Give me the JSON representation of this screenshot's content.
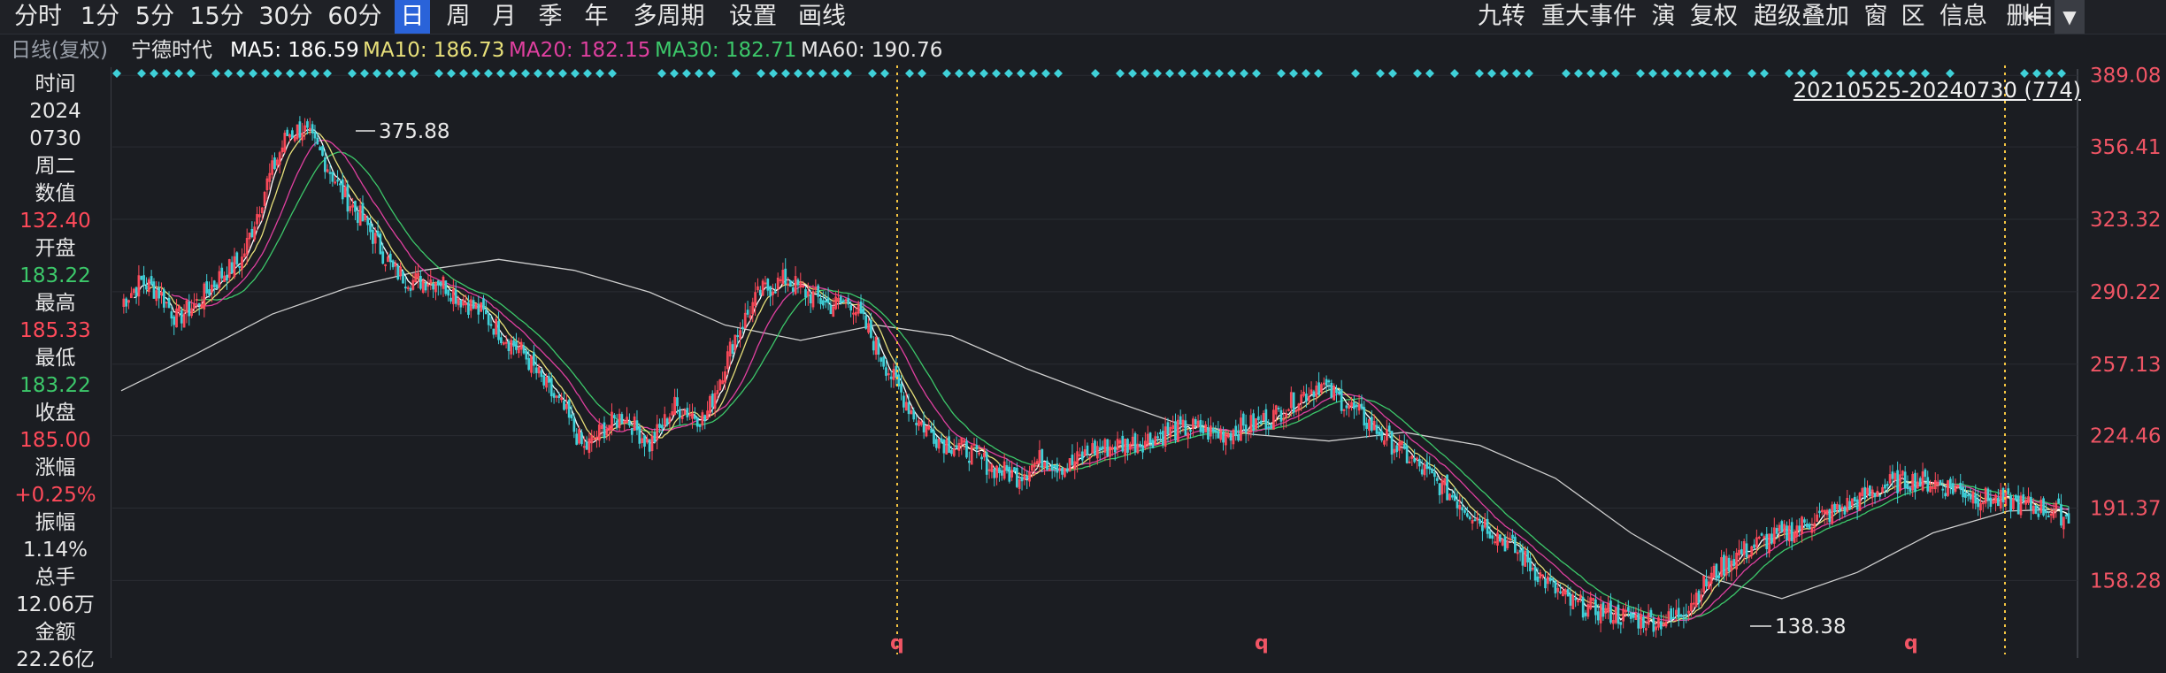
{
  "toolbar": {
    "left": [
      "分时",
      "1分",
      "5分",
      "15分",
      "30分",
      "60分",
      "日",
      "周",
      "月",
      "季",
      "年",
      "多周期",
      "设置",
      "画线"
    ],
    "active": "日",
    "right": [
      "九转",
      "重大事件",
      "演",
      "复权",
      "超级叠加",
      "窗",
      "区",
      "信息",
      "删自选"
    ],
    "collapse_icon": "collapse-icon",
    "dropdown_icon": "chevron-down-icon"
  },
  "info": {
    "period": "日线(复权)",
    "stock": "宁德时代",
    "ma5": "MA5: 186.59",
    "ma10": "MA10: 186.73",
    "ma20": "MA20: 182.15",
    "ma30": "MA30: 182.71",
    "ma60": "MA60: 190.76"
  },
  "panel": {
    "time_label": "时间",
    "date_year": "2024",
    "date_md": "0730",
    "weekday": "周二",
    "value_label": "数值",
    "value": "132.40",
    "open_label": "开盘",
    "open": "183.22",
    "high_label": "最高",
    "high": "185.33",
    "low_label": "最低",
    "low": "183.22",
    "close_label": "收盘",
    "close": "185.00",
    "change_label": "涨幅",
    "change": "+0.25%",
    "amplitude_label": "振幅",
    "amplitude": "1.14%",
    "volume_label": "总手",
    "volume": "12.06万",
    "amount_label": "金额",
    "amount": "22.26亿"
  },
  "range": "20210525-20240730 (774)",
  "colors": {
    "bg": "#1b1d22",
    "up": "#ff4a5a",
    "down": "#3fd0d8",
    "ma5": "#ffffff",
    "ma10": "#e8e07a",
    "ma20": "#e040a0",
    "ma30": "#3cc86a",
    "ma60": "#cfcfcf",
    "axis_text": "#f05565",
    "vline": "#f5c542"
  },
  "chart_data": {
    "type": "line",
    "title": "",
    "ylim": [
      135,
      392
    ],
    "y_ticks": [
      389.08,
      356.41,
      323.32,
      290.22,
      257.13,
      224.46,
      191.37,
      158.28
    ],
    "annotations": [
      {
        "text": "375.88",
        "date": "2021-12"
      },
      {
        "text": "138.38",
        "date": "2024-02"
      }
    ],
    "markers": [
      {
        "text": "q",
        "label": "vertical-marker"
      },
      {
        "text": "q",
        "label": "mid-marker"
      },
      {
        "text": "q",
        "label": "right-marker"
      }
    ],
    "close_path": [
      [
        0,
        285
      ],
      [
        8,
        295
      ],
      [
        15,
        290
      ],
      [
        22,
        278
      ],
      [
        30,
        285
      ],
      [
        40,
        298
      ],
      [
        48,
        305
      ],
      [
        58,
        340
      ],
      [
        66,
        362
      ],
      [
        72,
        365
      ],
      [
        80,
        352
      ],
      [
        88,
        335
      ],
      [
        98,
        320
      ],
      [
        108,
        300
      ],
      [
        116,
        295
      ],
      [
        126,
        296
      ],
      [
        134,
        288
      ],
      [
        144,
        280
      ],
      [
        152,
        270
      ],
      [
        160,
        262
      ],
      [
        168,
        248
      ],
      [
        176,
        236
      ],
      [
        184,
        218
      ],
      [
        192,
        228
      ],
      [
        200,
        234
      ],
      [
        210,
        220
      ],
      [
        220,
        238
      ],
      [
        232,
        232
      ],
      [
        244,
        270
      ],
      [
        254,
        290
      ],
      [
        264,
        296
      ],
      [
        272,
        290
      ],
      [
        282,
        284
      ],
      [
        290,
        286
      ],
      [
        298,
        270
      ],
      [
        306,
        252
      ],
      [
        316,
        232
      ],
      [
        326,
        222
      ],
      [
        336,
        218
      ],
      [
        346,
        210
      ],
      [
        356,
        206
      ],
      [
        366,
        214
      ],
      [
        376,
        210
      ],
      [
        386,
        218
      ],
      [
        396,
        220
      ],
      [
        406,
        222
      ],
      [
        416,
        226
      ],
      [
        426,
        228
      ],
      [
        436,
        225
      ],
      [
        446,
        228
      ],
      [
        456,
        232
      ],
      [
        466,
        240
      ],
      [
        476,
        248
      ],
      [
        486,
        240
      ],
      [
        496,
        230
      ],
      [
        506,
        220
      ],
      [
        516,
        210
      ],
      [
        526,
        200
      ],
      [
        536,
        190
      ],
      [
        546,
        180
      ],
      [
        556,
        170
      ],
      [
        566,
        158
      ],
      [
        576,
        148
      ],
      [
        586,
        145
      ],
      [
        596,
        142
      ],
      [
        606,
        140
      ],
      [
        616,
        140
      ],
      [
        622,
        146
      ],
      [
        632,
        160
      ],
      [
        642,
        170
      ],
      [
        652,
        176
      ],
      [
        662,
        180
      ],
      [
        672,
        186
      ],
      [
        682,
        190
      ],
      [
        692,
        196
      ],
      [
        702,
        202
      ],
      [
        710,
        204
      ],
      [
        720,
        203
      ],
      [
        730,
        200
      ],
      [
        740,
        196
      ],
      [
        750,
        194
      ],
      [
        760,
        192
      ],
      [
        768,
        190
      ],
      [
        774,
        187
      ]
    ],
    "ma60_path": [
      [
        0,
        245
      ],
      [
        30,
        262
      ],
      [
        60,
        280
      ],
      [
        90,
        292
      ],
      [
        120,
        300
      ],
      [
        150,
        305
      ],
      [
        180,
        300
      ],
      [
        210,
        290
      ],
      [
        240,
        275
      ],
      [
        270,
        268
      ],
      [
        300,
        275
      ],
      [
        330,
        270
      ],
      [
        360,
        255
      ],
      [
        390,
        242
      ],
      [
        420,
        230
      ],
      [
        450,
        225
      ],
      [
        480,
        222
      ],
      [
        510,
        226
      ],
      [
        540,
        220
      ],
      [
        570,
        205
      ],
      [
        600,
        180
      ],
      [
        630,
        160
      ],
      [
        660,
        150
      ],
      [
        690,
        162
      ],
      [
        720,
        180
      ],
      [
        750,
        190
      ],
      [
        774,
        191
      ]
    ]
  }
}
